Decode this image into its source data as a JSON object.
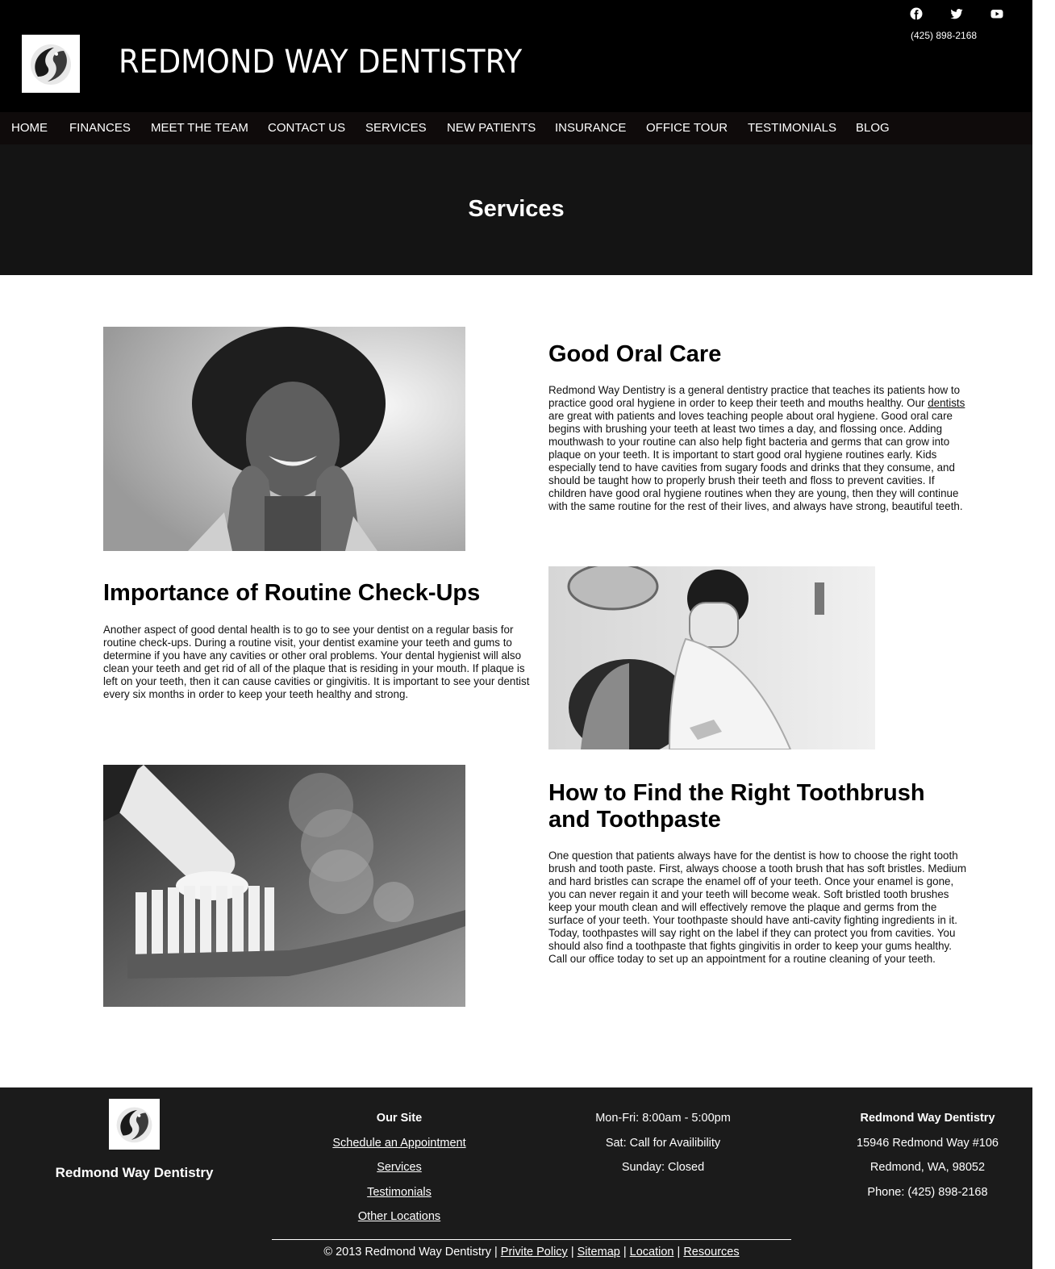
{
  "header": {
    "site_title": "REDMOND WAY DENTISTRY",
    "phone": "(425) 898-2168",
    "social_icons": [
      "facebook-icon",
      "twitter-icon",
      "youtube-icon"
    ]
  },
  "nav": {
    "items": [
      "HOME",
      "FINANCES",
      "MEET THE TEAM",
      "CONTACT US",
      "SERVICES",
      "NEW PATIENTS",
      "INSURANCE",
      "OFFICE TOUR",
      "TESTIMONIALS",
      "BLOG"
    ]
  },
  "banner": {
    "title": "Services"
  },
  "sections": [
    {
      "title": "Good Oral Care",
      "body_before_link": "Redmond Way Dentistry is a general dentistry practice that teaches its patients how to practice good oral hygiene in order to keep their teeth and mouths healthy. Our ",
      "link_text": "dentists",
      "body_after_link": " are great with patients and loves teaching people about oral hygiene. Good oral care begins with brushing your teeth at least two times a day, and flossing once. Adding mouthwash to your routine can also help fight bacteria and germs that can grow into plaque on your teeth. It is important to start good oral hygiene routines early. Kids especially tend to have cavities from sugary foods and drinks that they consume, and should be taught how to properly brush their teeth and floss to prevent cavities. If children have good oral hygiene routines when they are young, then they will continue with the same routine for the rest of their lives, and always have strong, beautiful teeth."
    },
    {
      "title": "Importance of Routine Check-Ups",
      "body": "Another aspect of good dental health is to go to see your dentist on a regular basis for routine check-ups. During a routine visit, your dentist examine your teeth and gums to determine if you have any cavities or other oral problems. Your dental hygienist will also clean your teeth and get rid of all of the plaque that is residing in your mouth. If plaque is left on your teeth, then it can cause cavities or gingivitis. It is important to see your dentist every six months in order to keep your teeth healthy and strong."
    },
    {
      "title": "How to Find the Right Toothbrush and Toothpaste",
      "body": "One question that patients always have for the dentist is how to choose the right tooth brush and tooth paste. First, always choose a tooth brush that has soft bristles. Medium and hard bristles can scrape the enamel off of your teeth. Once your enamel is gone, you can never regain it and your teeth will become weak. Soft bristled tooth brushes keep your mouth clean and will effectively remove the plaque and germs from the surface of your teeth. Your toothpaste should have anti-cavity fighting ingredients in it. Today, toothpastes will say right on the label if they can protect you from cavities. You should also find a toothpaste that fights gingivitis in order to keep your gums healthy. Call our office today to set up an appointment for a routine cleaning of your teeth."
    }
  ],
  "footer": {
    "brand": "Redmond Way Dentistry",
    "our_site": {
      "title": "Our Site",
      "links": [
        "Schedule an Appointment",
        "Services",
        "Testimonials",
        "Other Locations"
      ]
    },
    "hours": [
      "Mon-Fri: 8:00am - 5:00pm",
      "Sat: Call for Availibility",
      "Sunday: Closed"
    ],
    "contact": {
      "name": "Redmond Way Dentistry",
      "address1": "15946 Redmond Way #106",
      "address2": "Redmond, WA, 98052",
      "phone": "Phone: (425) 898-2168"
    },
    "bottom": {
      "copyright": "© 2013 Redmond Way Dentistry",
      "sep": " | ",
      "links": [
        "Privite Policy",
        "Sitemap",
        "Location",
        "Resources"
      ]
    }
  }
}
